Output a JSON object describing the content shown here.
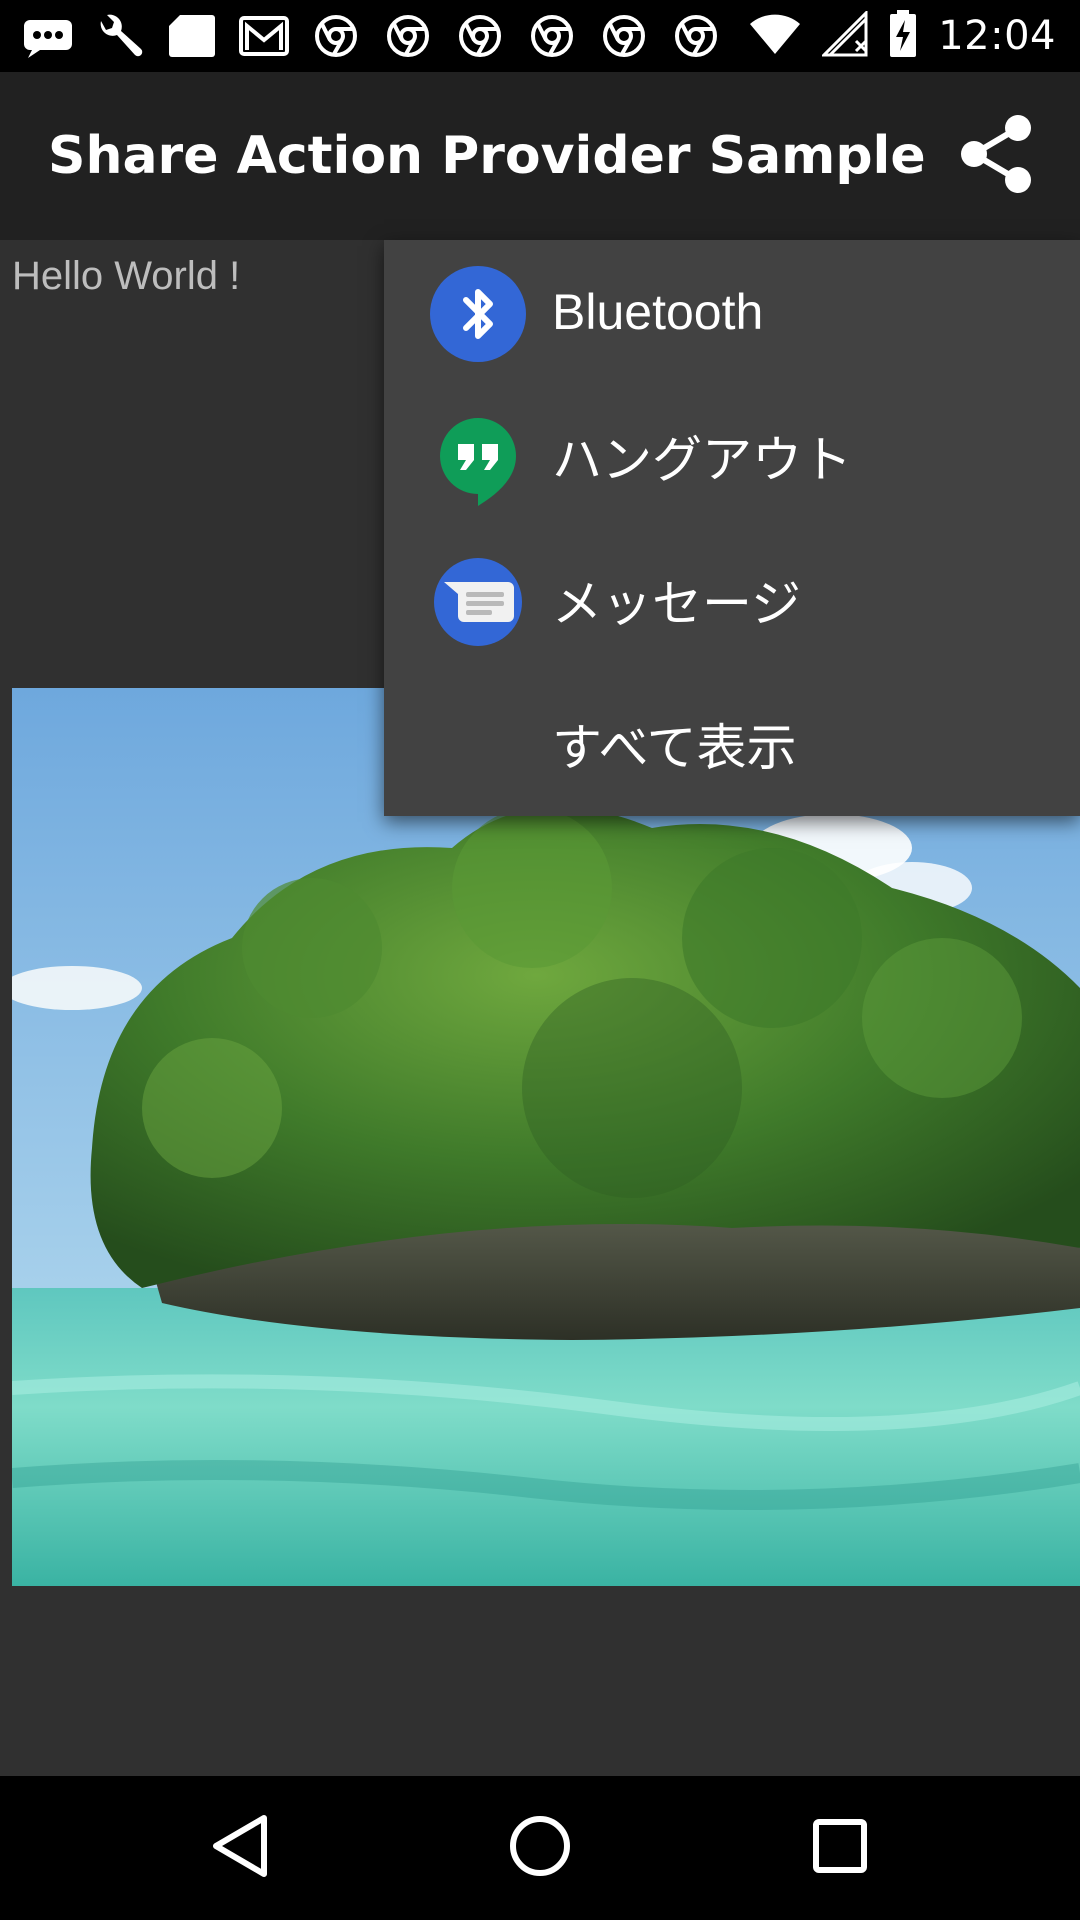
{
  "status_bar": {
    "time": "12:04",
    "icons": [
      "message-icon",
      "wrench-icon",
      "sd-card-icon",
      "gmail-icon",
      "chrome-icon",
      "chrome-icon",
      "chrome-icon",
      "chrome-icon",
      "chrome-icon",
      "chrome-icon",
      "wifi-icon",
      "signal-icon",
      "battery-charging-icon"
    ]
  },
  "app_bar": {
    "title": "Share Action Provider Sample",
    "share_icon": "share-icon"
  },
  "content": {
    "hello_text": "Hello World !"
  },
  "share_menu": {
    "items": [
      {
        "label": "Bluetooth",
        "icon": "bluetooth-icon",
        "color": "#3367d6"
      },
      {
        "label": "ハングアウト",
        "icon": "hangouts-icon",
        "color": "#0f9d58"
      },
      {
        "label": "メッセージ",
        "icon": "messages-icon",
        "color": "#3367d6"
      },
      {
        "label": "すべて表示",
        "icon": ""
      }
    ]
  },
  "nav_bar": {
    "buttons": [
      "back-icon",
      "home-icon",
      "recents-icon"
    ]
  },
  "colors": {
    "background": "#303030",
    "app_bar": "#212121",
    "menu": "#424242",
    "status_bar": "#000000"
  }
}
